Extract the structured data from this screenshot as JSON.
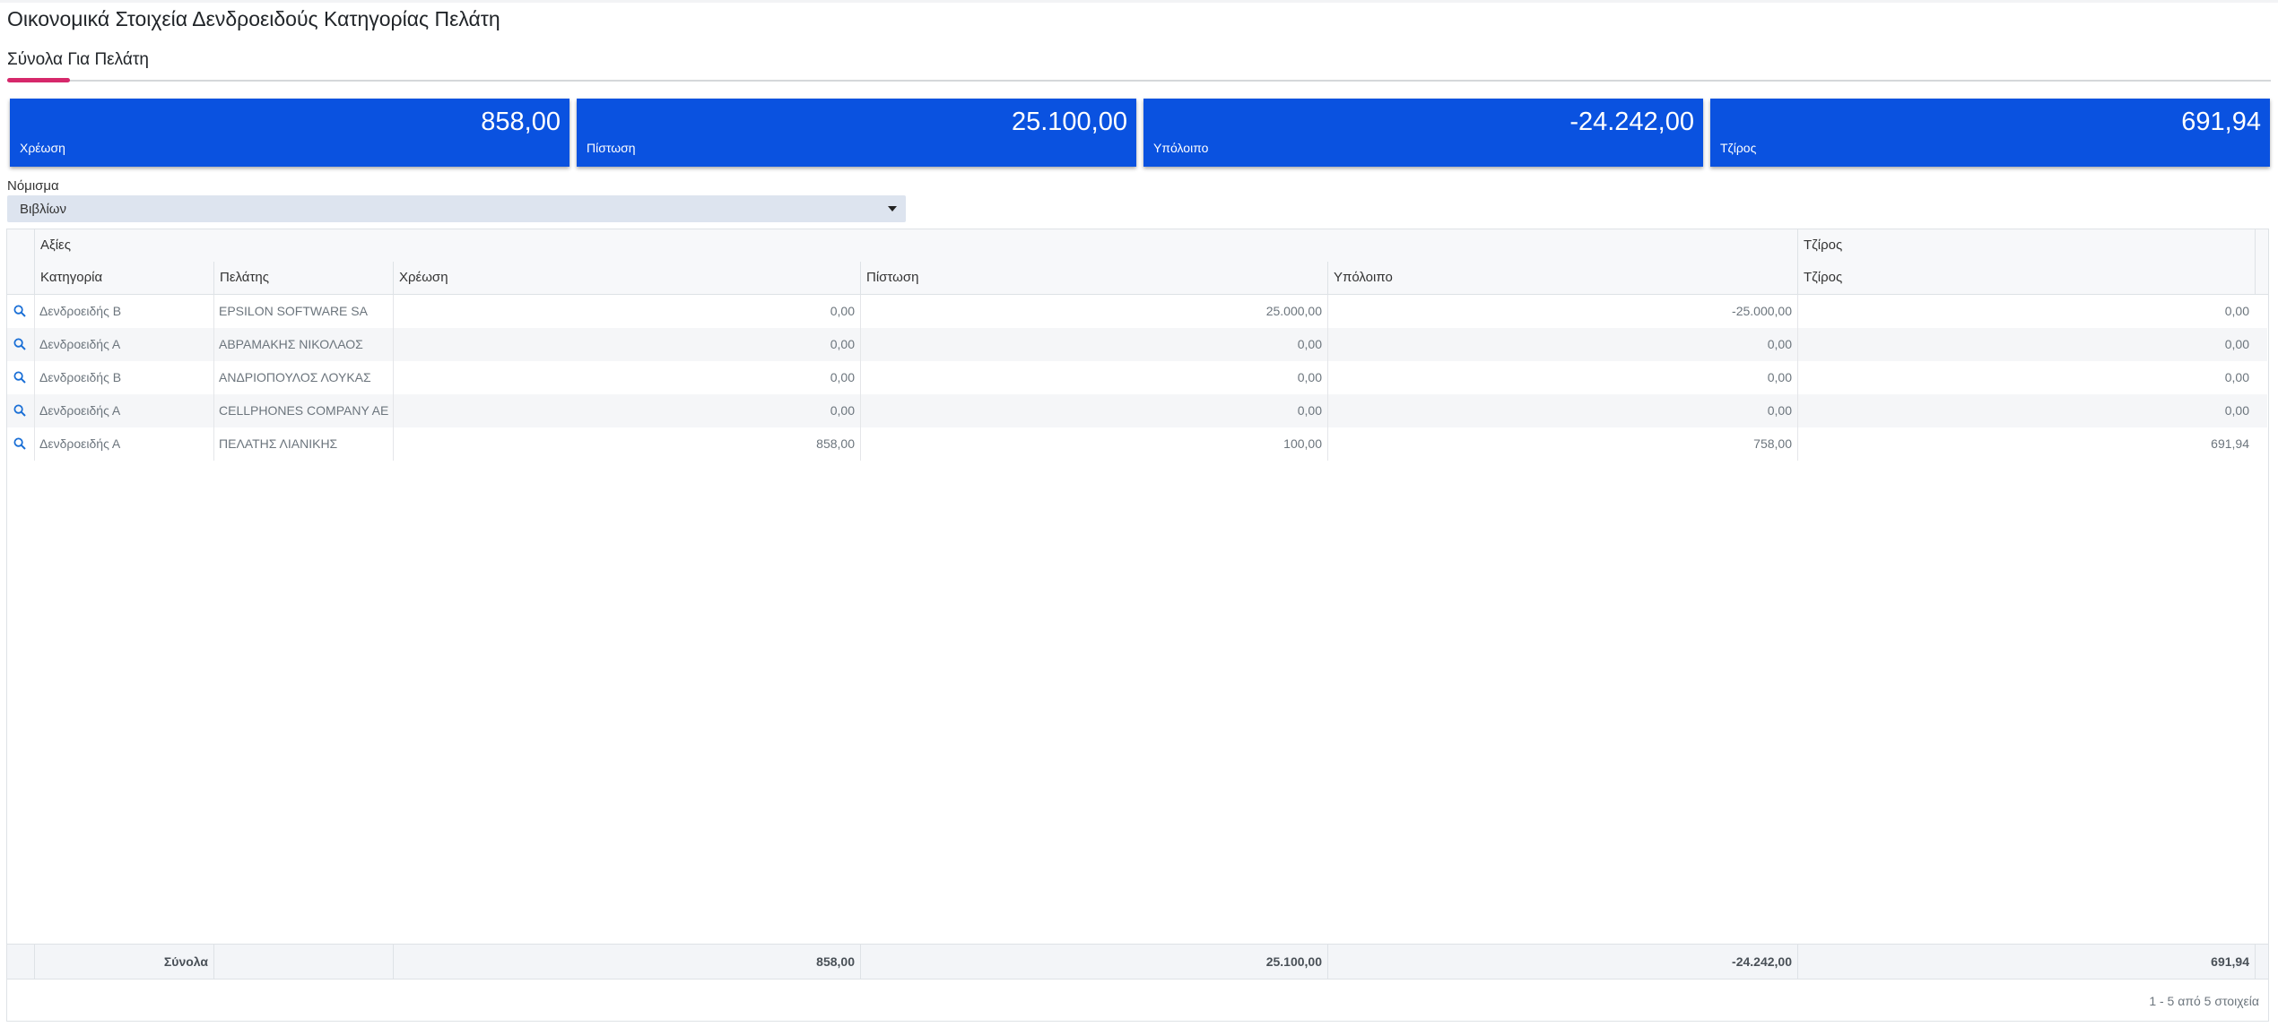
{
  "page": {
    "title": "Οικονομικά Στοιχεία Δενδροειδούς Κατηγορίας Πελάτη",
    "tab": "Σύνολα Για Πελάτη"
  },
  "kpis": [
    {
      "value": "858,00",
      "label": "Χρέωση"
    },
    {
      "value": "25.100,00",
      "label": "Πίστωση"
    },
    {
      "value": "-24.242,00",
      "label": "Υπόλοιπο"
    },
    {
      "value": "691,94",
      "label": "Τζίρος"
    }
  ],
  "currency": {
    "label": "Νόμισμα",
    "selected": "Βιβλίων"
  },
  "grid": {
    "group_headers": {
      "values": "Αξίες",
      "turnover": "Τζίρος"
    },
    "columns": {
      "category": "Κατηγορία",
      "customer": "Πελάτης",
      "debit": "Χρέωση",
      "credit": "Πίστωση",
      "balance": "Υπόλοιπο",
      "turnover": "Τζίρος"
    },
    "rows": [
      {
        "category": "Δενδροειδής Β",
        "customer": "EPSILON SOFTWARE SA",
        "debit": "0,00",
        "credit": "25.000,00",
        "balance": "-25.000,00",
        "turnover": "0,00"
      },
      {
        "category": "Δενδροειδής Α",
        "customer": "ΑΒΡΑΜΑΚΗΣ ΝΙΚΟΛΑΟΣ",
        "debit": "0,00",
        "credit": "0,00",
        "balance": "0,00",
        "turnover": "0,00"
      },
      {
        "category": "Δενδροειδής Β",
        "customer": "ΑΝΔΡΙΟΠΟΥΛΟΣ ΛΟΥΚΑΣ",
        "debit": "0,00",
        "credit": "0,00",
        "balance": "0,00",
        "turnover": "0,00"
      },
      {
        "category": "Δενδροειδής Α",
        "customer": "CELLPHONES COMPANY AE",
        "debit": "0,00",
        "credit": "0,00",
        "balance": "0,00",
        "turnover": "0,00"
      },
      {
        "category": "Δενδροειδής Α",
        "customer": "ΠΕΛΑΤΗΣ ΛΙΑΝΙΚΗΣ",
        "debit": "858,00",
        "credit": "100,00",
        "balance": "758,00",
        "turnover": "691,94"
      }
    ],
    "totals": {
      "label": "Σύνολα",
      "debit": "858,00",
      "credit": "25.100,00",
      "balance": "-24.242,00",
      "turnover": "691,94"
    },
    "pager": "1 - 5 από 5 στοιχεία"
  },
  "icons": {
    "row_action": "search-icon",
    "dropdown": "caret-down-icon"
  },
  "colors": {
    "kpi_background": "#0a52e0",
    "tab_accent": "#d6286b",
    "link_icon": "#1a6fd6"
  }
}
